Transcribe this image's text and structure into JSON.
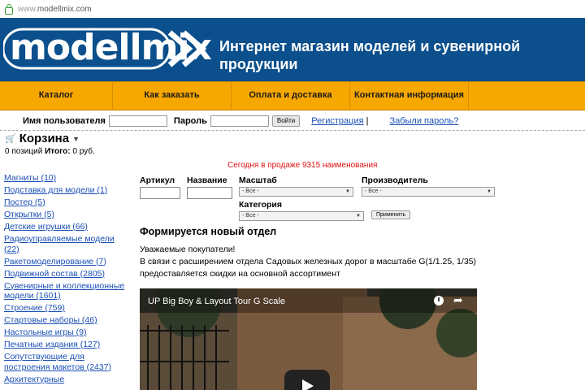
{
  "address_bar": {
    "url_prefix": "www.",
    "url_host": "modellmix.com"
  },
  "header": {
    "logo_text": "modellmix",
    "slogan": "Интернет магазин моделей и сувенирной продукции",
    "colors": {
      "header_bg": "#0b4f8c",
      "menu_bg": "#f7a800"
    }
  },
  "menu": {
    "items": [
      {
        "label": "Каталог"
      },
      {
        "label": "Как заказать"
      },
      {
        "label": "Оплата и доставка"
      },
      {
        "label": "Контактная информация"
      }
    ]
  },
  "login": {
    "username_label": "Имя пользователя",
    "password_label": "Пароль",
    "login_button": "Войти",
    "register_link": "Регистрация",
    "separator": "|",
    "forgot_link": "Забыли пароль?"
  },
  "cart": {
    "title": "Корзина",
    "count_text": "0 позиций",
    "total_label": "Итого:",
    "total_value": "0 руб."
  },
  "today_text": "Сегодня в продаже 9315 наименования",
  "sidebar": {
    "categories": [
      "Магниты (10)",
      "Подставка для модели (1)",
      "Постер (5)",
      "Открытки (5)",
      "Детские игрушки (66)",
      "Радиоуправляемые модели (22)",
      "Ракетомоделирование (7)",
      "Подвижной состав (2805)",
      "Сувенирные и коллекционные модели (1601)",
      "Строение (759)",
      "Стартовые наборы (46)",
      "Настольные игры (9)",
      "Печатные издания (127)",
      "Сопутствующие для построения макетов (2437)",
      "Архитектурные"
    ]
  },
  "filters": {
    "article_label": "Артикул",
    "name_label": "Название",
    "scale_label": "Масштаб",
    "scale_value": "- Все -",
    "manufacturer_label": "Производитель",
    "manufacturer_value": "- Все -",
    "category_label": "Категория",
    "category_value": "- Все -",
    "apply_button": "Применить"
  },
  "news": {
    "title": "Формируется новый отдел",
    "greeting": "Уважаемые покупатели!",
    "line1": "В связи с расширением отдела Садовых железных дорог в масштабе G(1/1.25, 1/35)",
    "line2": "предоставляется скидки на основной ассортимент"
  },
  "video": {
    "title": "UP Big Boy & Layout Tour G Scale"
  }
}
